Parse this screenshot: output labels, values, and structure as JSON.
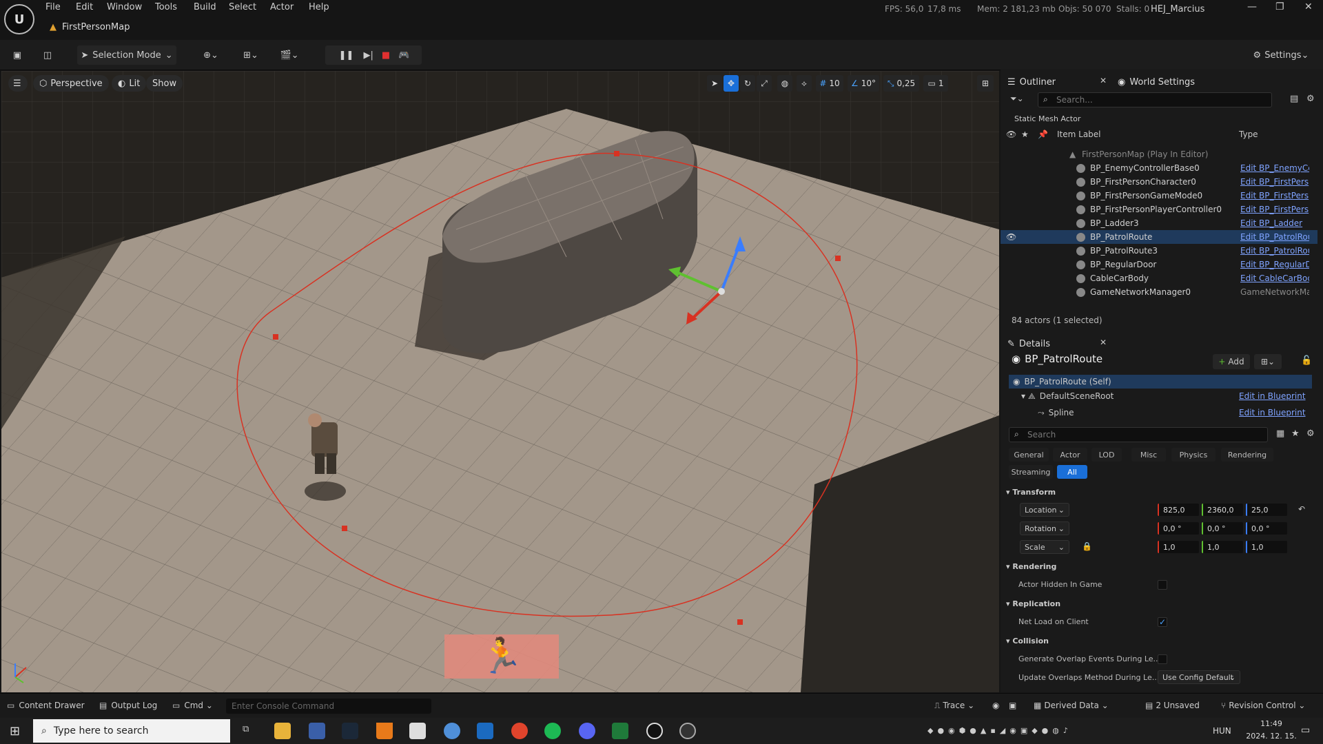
{
  "menu": [
    "File",
    "Edit",
    "Window",
    "Tools",
    "Build",
    "Select",
    "Actor",
    "Help"
  ],
  "stats": {
    "fps": "FPS: 56,0",
    "ms": "17,8 ms",
    "mem": "Mem: 2 181,23 mb",
    "objs": "Objs: 50 070",
    "stalls": "Stalls: 0"
  },
  "user": "HEJ_Marcius",
  "map_tab": "FirstPersonMap",
  "toolbar": {
    "mode": "Selection Mode",
    "settings": "Settings"
  },
  "viewport": {
    "perspective": "Perspective",
    "lit": "Lit",
    "show": "Show",
    "grid": "10",
    "angle": "10°",
    "scale": "0,25",
    "camera": "1"
  },
  "outliner": {
    "tab": "Outliner",
    "tab2": "World Settings",
    "search_placeholder": "Search...",
    "filter_label": "Static Mesh Actor",
    "col_label": "Item Label",
    "col_type": "Type",
    "root": "FirstPersonMap (Play In Editor)",
    "rows": [
      {
        "label": "BP_EnemyControllerBase0",
        "type": "Edit BP_EnemyCc"
      },
      {
        "label": "BP_FirstPersonCharacter0",
        "type": "Edit BP_FirstPers"
      },
      {
        "label": "BP_FirstPersonGameMode0",
        "type": "Edit BP_FirstPers"
      },
      {
        "label": "BP_FirstPersonPlayerController0",
        "type": "Edit BP_FirstPers"
      },
      {
        "label": "BP_Ladder3",
        "type": "Edit BP_Ladder"
      },
      {
        "label": "BP_PatrolRoute",
        "type": "Edit BP_PatrolRou"
      },
      {
        "label": "BP_PatrolRoute3",
        "type": "Edit BP_PatrolRou"
      },
      {
        "label": "BP_RegularDoor",
        "type": "Edit BP_RegularD"
      },
      {
        "label": "CableCarBody",
        "type": "Edit CableCarBod"
      },
      {
        "label": "GameNetworkManager0",
        "type": "GameNetworkMa"
      }
    ],
    "count": "84 actors (1 selected)"
  },
  "details": {
    "tab": "Details",
    "actor": "BP_PatrolRoute",
    "add": "Add",
    "self": "BP_PatrolRoute (Self)",
    "comp_root": "DefaultSceneRoot",
    "comp_spline": "Spline",
    "edit_bp": "Edit in Blueprint",
    "search_placeholder": "Search",
    "filters": [
      "General",
      "Actor",
      "LOD",
      "Misc",
      "Physics",
      "Rendering"
    ],
    "filters2": [
      "Streaming",
      "All"
    ],
    "transform": "Transform",
    "location": "Location",
    "rotation": "Rotation",
    "scale": "Scale",
    "loc": [
      "825,0",
      "2360,0",
      "25,0"
    ],
    "rot": [
      "0,0 °",
      "0,0 °",
      "0,0 °"
    ],
    "scl": [
      "1,0",
      "1,0",
      "1,0"
    ],
    "rendering": "Rendering",
    "hidden": "Actor Hidden In Game",
    "replication": "Replication",
    "netload": "Net Load on Client",
    "collision": "Collision",
    "overlap": "Generate Overlap Events During Le...",
    "update": "Update Overlaps Method During Le...",
    "update_val": "Use Config Default"
  },
  "status": {
    "content": "Content Drawer",
    "output": "Output Log",
    "cmd": "Cmd",
    "console_placeholder": "Enter Console Command",
    "trace": "Trace",
    "derived": "Derived Data",
    "unsaved": "2 Unsaved",
    "revision": "Revision Control"
  },
  "taskbar": {
    "search": "Type here to search",
    "lang": "HUN",
    "time": "11:49",
    "date": "2024. 12. 15."
  }
}
